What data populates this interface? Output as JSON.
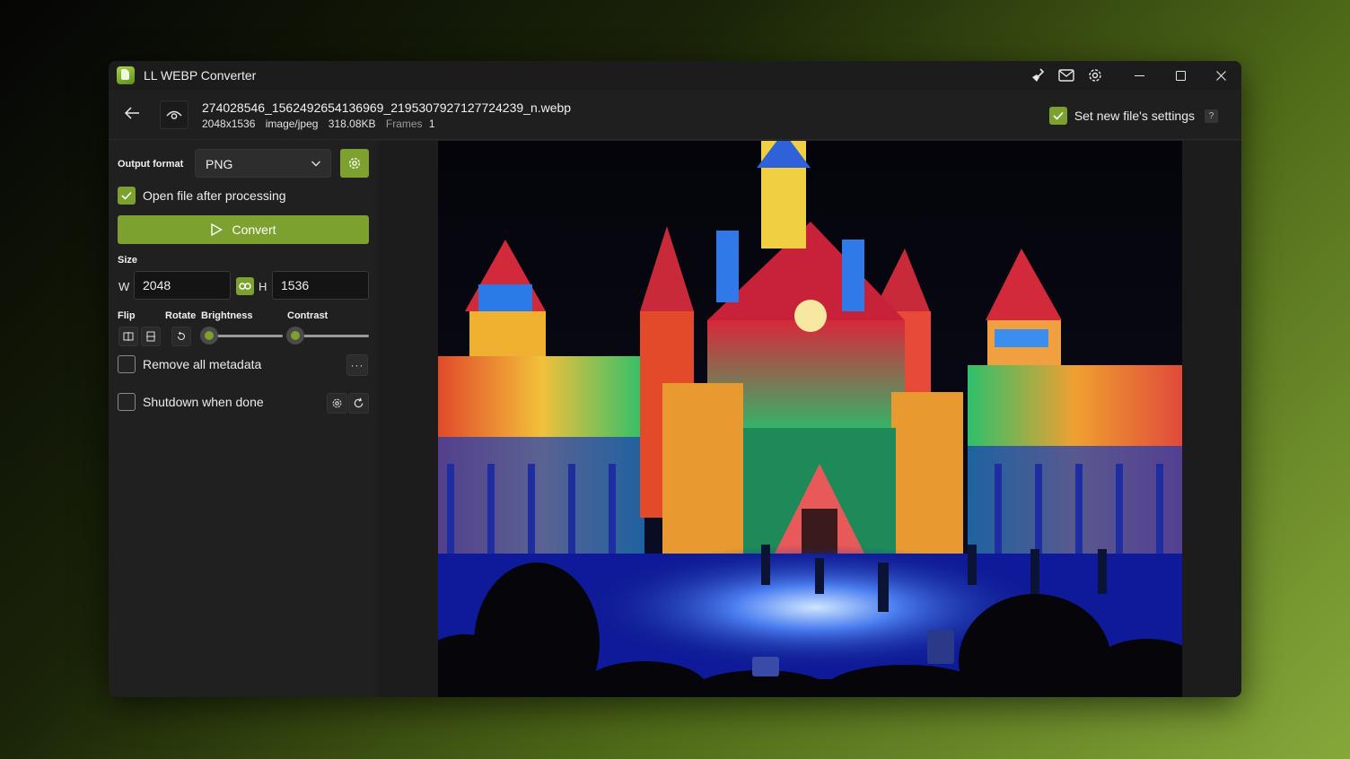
{
  "app": {
    "title": "LL WEBP Converter"
  },
  "titlebar": {
    "icons": [
      "broom-icon",
      "mail-icon",
      "gear-icon"
    ],
    "window_controls": [
      "minimize-icon",
      "maximize-icon",
      "close-icon"
    ]
  },
  "file": {
    "name": "274028546_1562492654136969_2195307927127724239_n.webp",
    "dimensions": "2048x1536",
    "mime": "image/jpeg",
    "size": "318.08KB",
    "frames_label": "Frames",
    "frames": "1"
  },
  "header": {
    "set_new_label": "Set new file's settings",
    "help": "?"
  },
  "panel": {
    "output_format_label": "Output format",
    "output_format_value": "PNG",
    "open_after_label": "Open file after processing",
    "convert_label": "Convert",
    "size_label": "Size",
    "w_label": "W",
    "h_label": "H",
    "width": "2048",
    "height": "1536",
    "flip_label": "Flip",
    "rotate_label": "Rotate",
    "brightness_label": "Brightness",
    "contrast_label": "Contrast",
    "remove_metadata_label": "Remove all metadata",
    "more_label": "···",
    "shutdown_label": "Shutdown when done",
    "brightness_value": 0,
    "contrast_value": 0
  },
  "colors": {
    "accent": "#7da12f",
    "window_bg": "#202020",
    "preview_bg": "#1c1c1c"
  }
}
